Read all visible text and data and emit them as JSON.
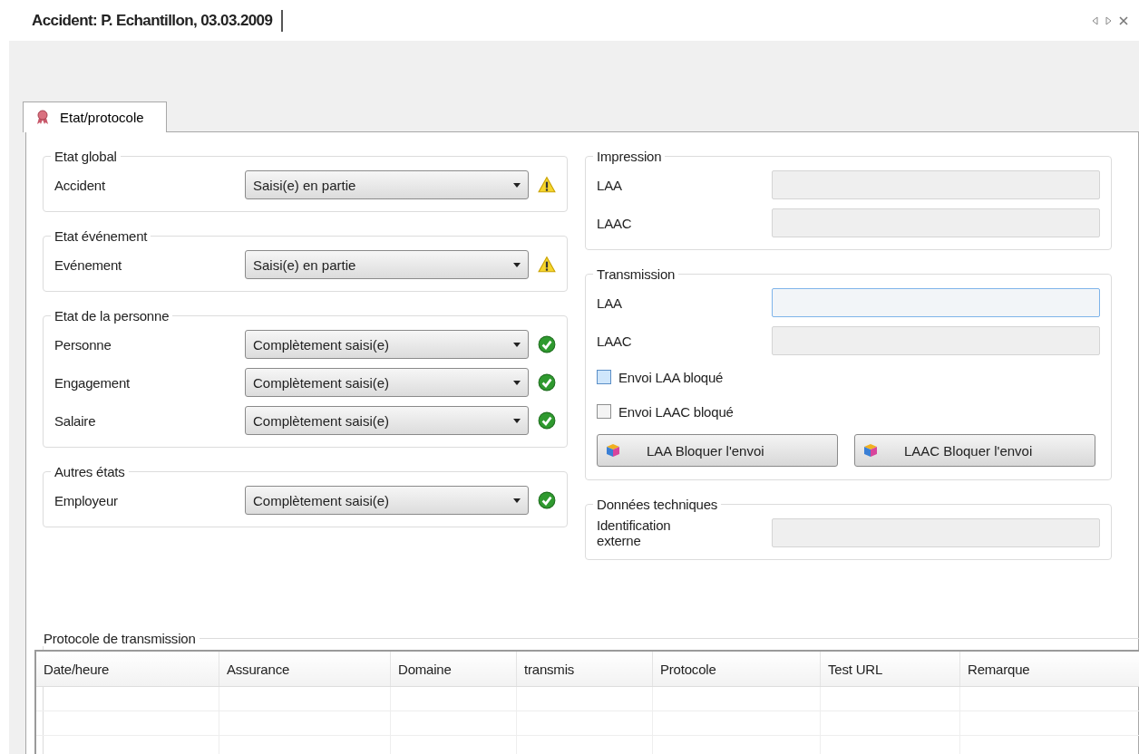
{
  "window": {
    "title": "Accident: P. Echantillon, 03.03.2009"
  },
  "tabs": [
    {
      "label": "Etat/protocole",
      "selected": true
    }
  ],
  "status_groups": [
    {
      "title": "Etat global",
      "rows": [
        {
          "label": "Accident",
          "value": "Saisi(e) en partie",
          "kind": "warning"
        }
      ]
    },
    {
      "title": "Etat événement",
      "rows": [
        {
          "label": "Evénement",
          "value": "Saisi(e) en partie",
          "kind": "warning"
        }
      ]
    },
    {
      "title": "Etat de la personne",
      "rows": [
        {
          "label": "Personne",
          "value": "Complètement saisi(e)",
          "kind": "ok"
        },
        {
          "label": "Engagement",
          "value": "Complètement saisi(e)",
          "kind": "ok"
        },
        {
          "label": "Salaire",
          "value": "Complètement saisi(e)",
          "kind": "ok"
        }
      ]
    },
    {
      "title": "Autres états",
      "rows": [
        {
          "label": "Employeur",
          "value": "Complètement saisi(e)",
          "kind": "ok"
        }
      ]
    }
  ],
  "impression": {
    "title": "Impression",
    "fields": [
      {
        "label": "LAA",
        "focused": false
      },
      {
        "label": "LAAC",
        "focused": false
      }
    ]
  },
  "transmission": {
    "title": "Transmission",
    "fields": [
      {
        "label": "LAA",
        "focused": true
      },
      {
        "label": "LAAC",
        "focused": false
      }
    ],
    "checkboxes": [
      {
        "label": "Envoi LAA bloqué",
        "checked": false,
        "focused": true
      },
      {
        "label": "Envoi LAAC bloqué",
        "checked": false,
        "focused": false
      }
    ],
    "buttons": [
      "LAA Bloquer l'envoi",
      "LAAC Bloquer l'envoi"
    ]
  },
  "technical": {
    "title": "Données techniques",
    "fields": [
      {
        "label": "Identification externe",
        "focused": false
      }
    ]
  },
  "protocol": {
    "title": "Protocole de transmission",
    "columns": [
      "Date/heure",
      "Assurance",
      "Domaine",
      "transmis",
      "Protocole",
      "Test URL",
      "Remarque"
    ]
  }
}
